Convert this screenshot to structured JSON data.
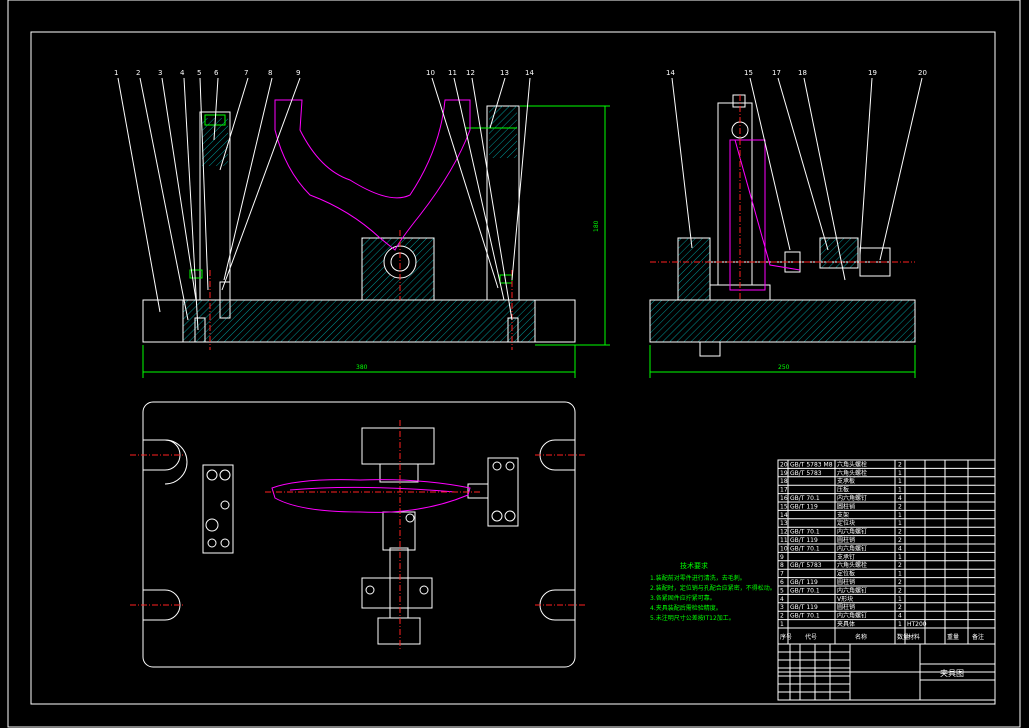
{
  "drawing": {
    "front_view_labels": [
      "1",
      "2",
      "3",
      "4",
      "5",
      "6",
      "7",
      "8",
      "9",
      "10",
      "11",
      "12",
      "13",
      "14"
    ],
    "side_view_labels": [
      "14",
      "15",
      "17",
      "18",
      "19",
      "20"
    ],
    "dim_overall_width": "380",
    "dim_height": "180",
    "dim_side_width": "250"
  },
  "tech_notes": {
    "title": "技术要求",
    "lines": [
      "1.装配前对零件进行清洗，去毛刺。",
      "2.装配时，定位销与孔配合应紧密，不得松动。",
      "3.各紧固件应拧紧可靠。",
      "4.夹具装配后需检验精度。",
      "5.未注明尺寸公差按IT12加工。"
    ]
  },
  "bom": {
    "header": {
      "no": "序号",
      "code": "代号",
      "name": "名称",
      "qty": "数量",
      "material": "材料",
      "weight": "重量",
      "remark": "备注"
    },
    "rows": [
      {
        "no": "20",
        "code": "GB/T 5783 M8",
        "name": "六角头螺栓",
        "qty": "2"
      },
      {
        "no": "19",
        "code": "GB/T 5783",
        "name": "六角头螺栓",
        "qty": "1"
      },
      {
        "no": "18",
        "code": "",
        "name": "支承板",
        "qty": "1"
      },
      {
        "no": "17",
        "code": "",
        "name": "压板",
        "qty": "1"
      },
      {
        "no": "16",
        "code": "GB/T 70.1",
        "name": "内六角螺钉",
        "qty": "4"
      },
      {
        "no": "15",
        "code": "GB/T 119",
        "name": "圆柱销",
        "qty": "2"
      },
      {
        "no": "14",
        "code": "",
        "name": "支架",
        "qty": "1"
      },
      {
        "no": "13",
        "code": "",
        "name": "定位块",
        "qty": "1"
      },
      {
        "no": "12",
        "code": "GB/T 70.1",
        "name": "内六角螺钉",
        "qty": "2"
      },
      {
        "no": "11",
        "code": "GB/T 119",
        "name": "圆柱销",
        "qty": "2"
      },
      {
        "no": "10",
        "code": "GB/T 70.1",
        "name": "内六角螺钉",
        "qty": "4"
      },
      {
        "no": "9",
        "code": "",
        "name": "支承钉",
        "qty": "1"
      },
      {
        "no": "8",
        "code": "GB/T 5783",
        "name": "六角头螺栓",
        "qty": "2"
      },
      {
        "no": "7",
        "code": "",
        "name": "定位板",
        "qty": "1"
      },
      {
        "no": "6",
        "code": "GB/T 119",
        "name": "圆柱销",
        "qty": "2"
      },
      {
        "no": "5",
        "code": "GB/T 70.1",
        "name": "内六角螺钉",
        "qty": "2"
      },
      {
        "no": "4",
        "code": "",
        "name": "V形块",
        "qty": "1"
      },
      {
        "no": "3",
        "code": "GB/T 119",
        "name": "圆柱销",
        "qty": "2"
      },
      {
        "no": "2",
        "code": "GB/T 70.1",
        "name": "内六角螺钉",
        "qty": "4"
      },
      {
        "no": "1",
        "code": "",
        "name": "夹具体",
        "qty": "1",
        "material": "HT200"
      }
    ],
    "title_block_name": "夹具图"
  }
}
